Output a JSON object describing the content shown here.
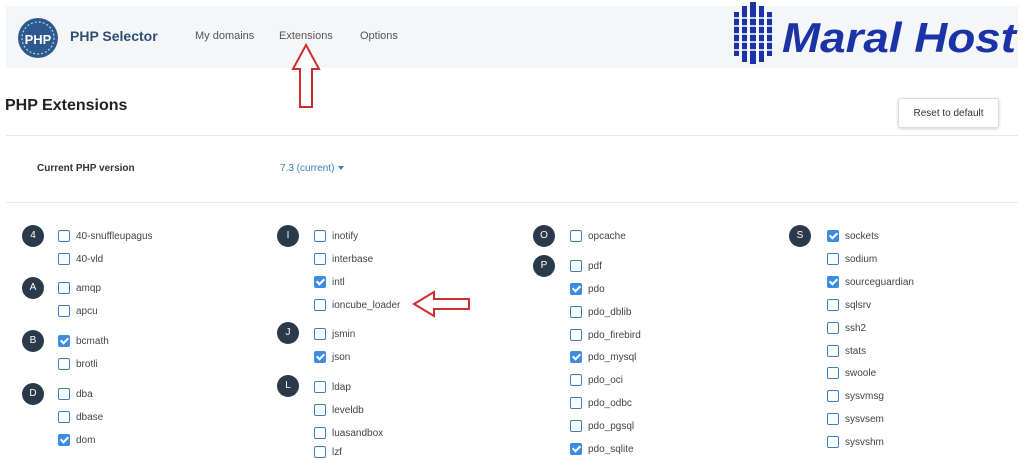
{
  "app": {
    "title": "PHP Selector",
    "logo_text": "PHP"
  },
  "nav": [
    "My domains",
    "Extensions",
    "Options"
  ],
  "brand": {
    "name": "Maral Host",
    "color": "#1b33a6"
  },
  "page": {
    "title": "PHP Extensions",
    "reset_label": "Reset to default"
  },
  "version": {
    "label": "Current PHP version",
    "value": "7.3 (current)"
  },
  "accent_color": "#3a8de0",
  "annotation_color": "#cc2d2d",
  "groups": [
    {
      "letter": "4",
      "items": [
        {
          "name": "40-snuffleupagus",
          "checked": false
        },
        {
          "name": "40-vld",
          "checked": false
        }
      ]
    },
    {
      "letter": "A",
      "items": [
        {
          "name": "amqp",
          "checked": false
        },
        {
          "name": "apcu",
          "checked": false
        }
      ]
    },
    {
      "letter": "B",
      "items": [
        {
          "name": "bcmath",
          "checked": true
        },
        {
          "name": "brotli",
          "checked": false
        }
      ]
    },
    {
      "letter": "D",
      "items": [
        {
          "name": "dba",
          "checked": false
        },
        {
          "name": "dbase",
          "checked": false
        },
        {
          "name": "dom",
          "checked": true
        }
      ]
    },
    {
      "letter": "I",
      "items": [
        {
          "name": "inotify",
          "checked": false
        },
        {
          "name": "interbase",
          "checked": false
        },
        {
          "name": "intl",
          "checked": true
        },
        {
          "name": "ioncube_loader",
          "checked": false
        }
      ]
    },
    {
      "letter": "J",
      "items": [
        {
          "name": "jsmin",
          "checked": false
        },
        {
          "name": "json",
          "checked": true
        }
      ]
    },
    {
      "letter": "L",
      "items": [
        {
          "name": "ldap",
          "checked": false
        },
        {
          "name": "leveldb",
          "checked": false
        },
        {
          "name": "luasandbox",
          "checked": false
        },
        {
          "name": "lzf",
          "checked": false
        }
      ]
    },
    {
      "letter": "O",
      "items": [
        {
          "name": "opcache",
          "checked": false
        }
      ]
    },
    {
      "letter": "P",
      "items": [
        {
          "name": "pdf",
          "checked": false
        },
        {
          "name": "pdo",
          "checked": true
        },
        {
          "name": "pdo_dblib",
          "checked": false
        },
        {
          "name": "pdo_firebird",
          "checked": false
        },
        {
          "name": "pdo_mysql",
          "checked": true
        },
        {
          "name": "pdo_oci",
          "checked": false
        },
        {
          "name": "pdo_odbc",
          "checked": false
        },
        {
          "name": "pdo_pgsql",
          "checked": false
        },
        {
          "name": "pdo_sqlite",
          "checked": true
        }
      ]
    },
    {
      "letter": "S",
      "items": [
        {
          "name": "sockets",
          "checked": true
        },
        {
          "name": "sodium",
          "checked": false
        },
        {
          "name": "sourceguardian",
          "checked": true
        },
        {
          "name": "sqlsrv",
          "checked": false
        },
        {
          "name": "ssh2",
          "checked": false
        },
        {
          "name": "stats",
          "checked": false
        },
        {
          "name": "swoole",
          "checked": false
        },
        {
          "name": "sysvmsg",
          "checked": false
        },
        {
          "name": "sysvsem",
          "checked": false
        },
        {
          "name": "sysvshm",
          "checked": false
        }
      ]
    }
  ]
}
